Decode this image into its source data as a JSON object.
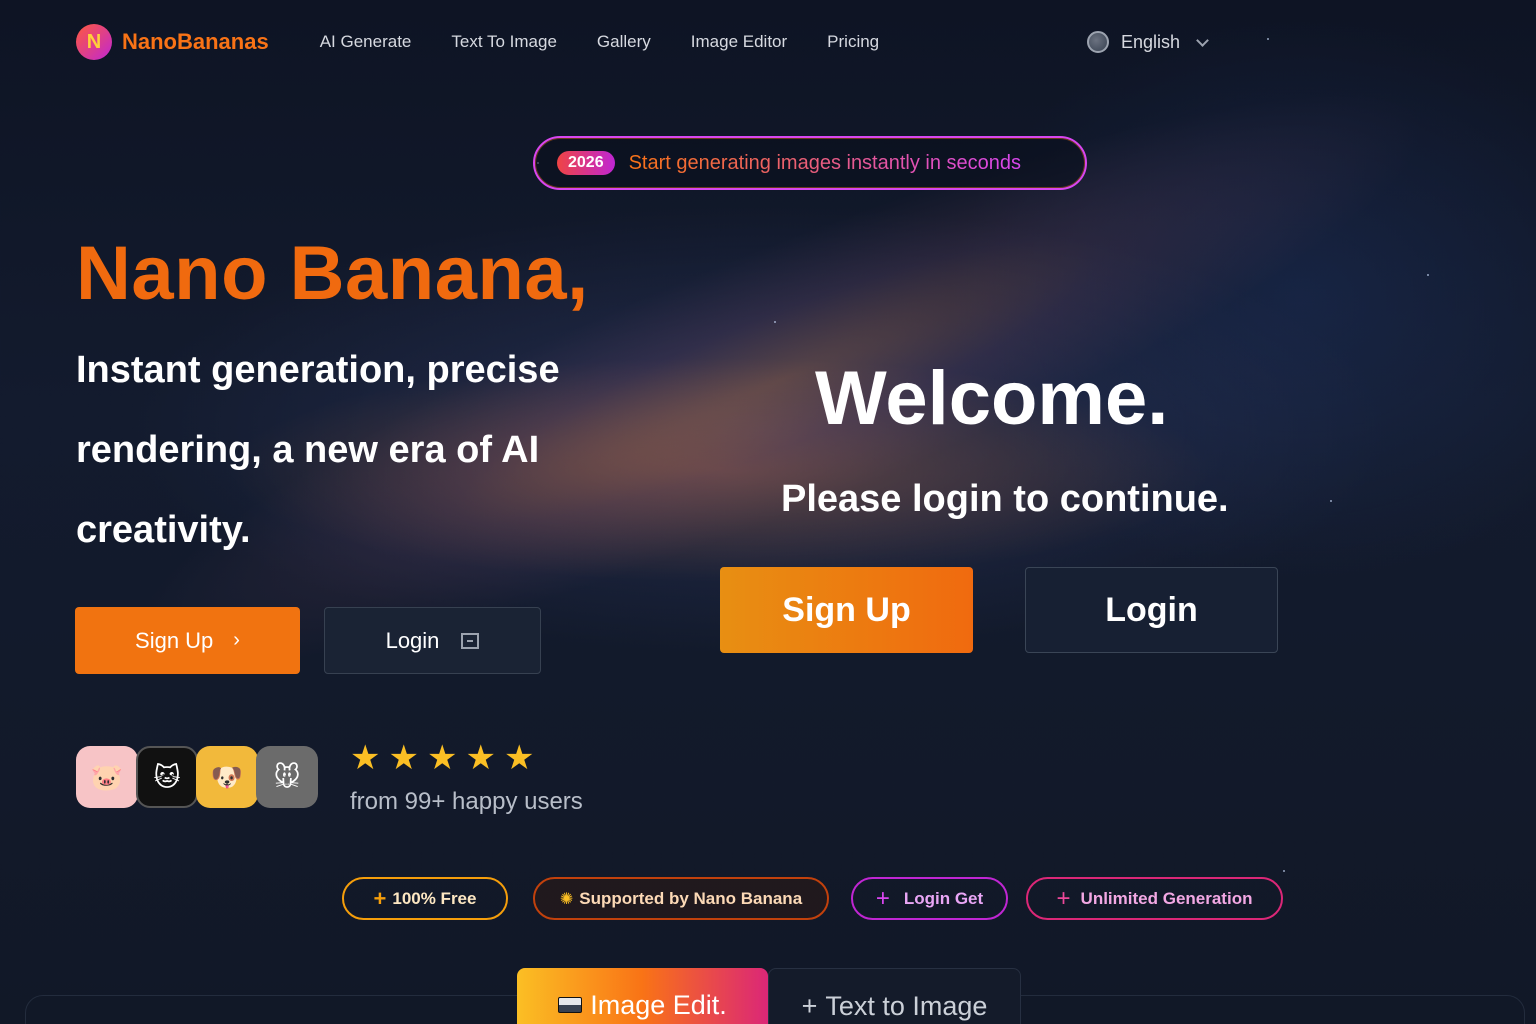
{
  "nav": {
    "brand": "NanoBananas",
    "brand_mark": "N",
    "links": [
      "AI Generate",
      "Text To Image",
      "Gallery",
      "Image Editor",
      "Pricing"
    ],
    "language": "English"
  },
  "badge": {
    "year": "2026",
    "text": "Start generating images instantly in seconds"
  },
  "hero": {
    "title": "Nano Banana,",
    "subtitle": "Instant generation, precise rendering, a new era of AI creativity.",
    "signup_label": "Sign Up",
    "signup_arrow": "›",
    "login_label": "Login"
  },
  "rating": {
    "star": "★",
    "stars": 5,
    "text": "from 99+ happy users",
    "avatars": [
      "🐷",
      "🐱",
      "🐶",
      "🐭"
    ]
  },
  "welcome": {
    "title": "Welcome.",
    "subtitle": "Please login to continue.",
    "signup_label": "Sign Up",
    "login_label": "Login"
  },
  "pills": {
    "free": "100% Free",
    "supported": "Supported by Nano Banana",
    "login_get": "Login Get",
    "unlimited": "Unlimited Generation"
  },
  "tabs": {
    "image_edit": "Image Edit.",
    "text_to_image": "Text to Image",
    "text_to_image_prefix": "+"
  },
  "colors": {
    "accent_orange": "#f06a0f",
    "accent_magenta": "#d946ef",
    "star": "#fbbf24"
  }
}
